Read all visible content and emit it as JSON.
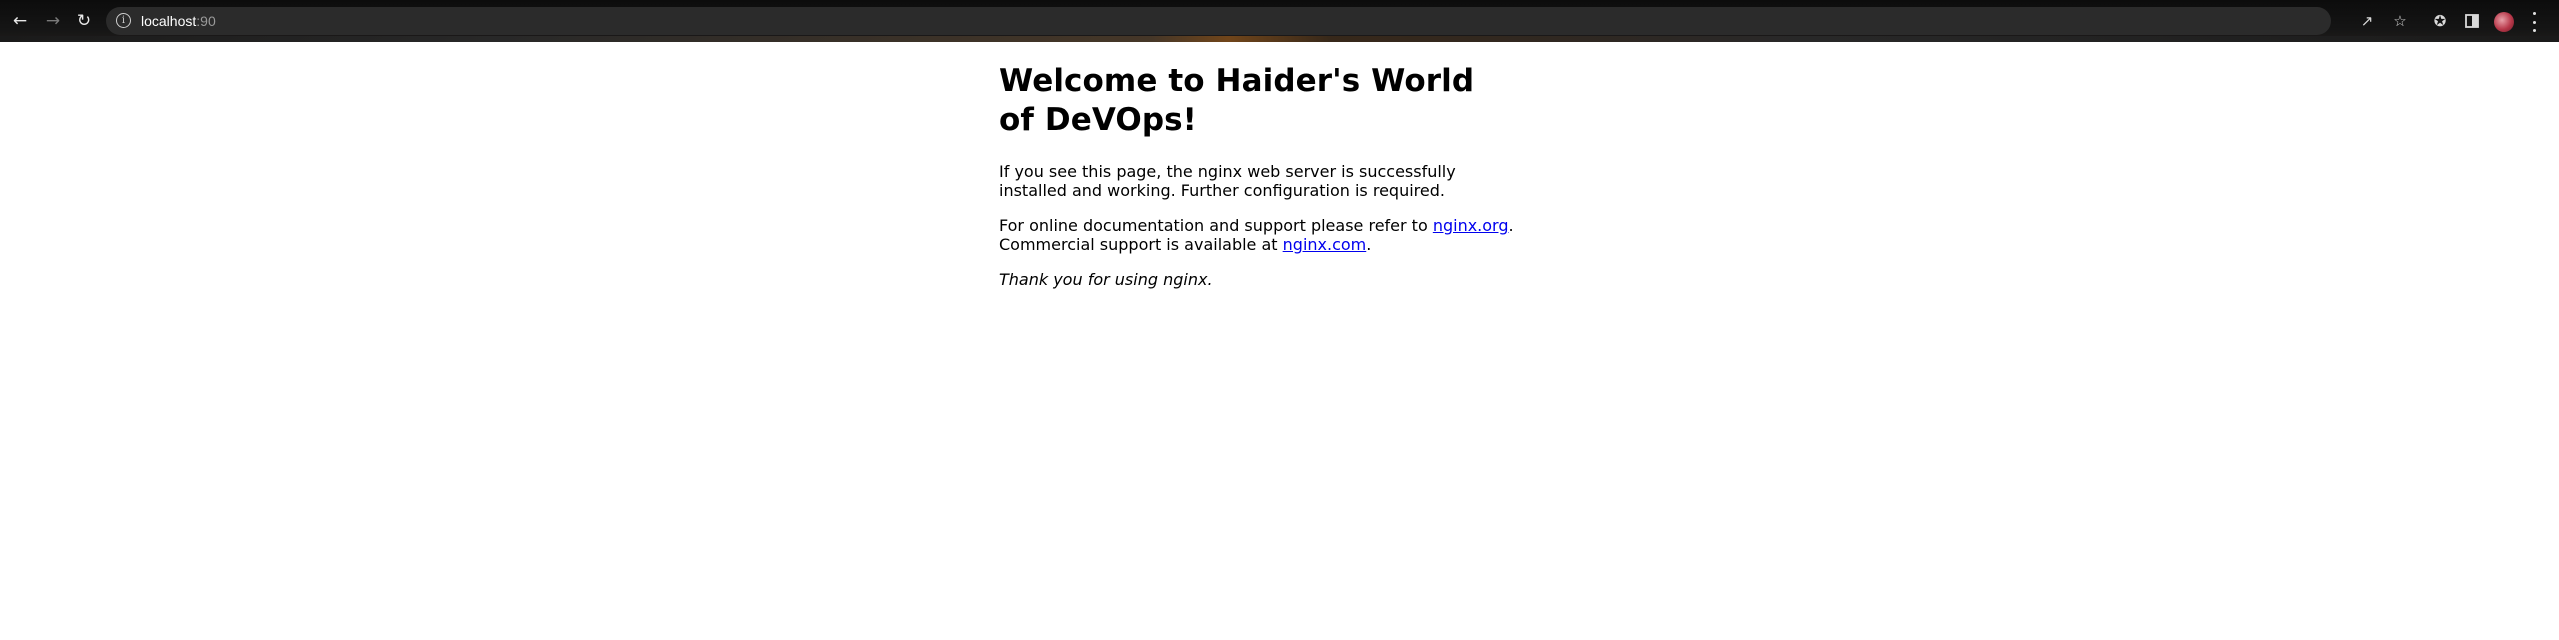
{
  "browser": {
    "url_host": "localhost",
    "url_port": ":90",
    "icons": {
      "back": "back-arrow-icon",
      "forward": "forward-arrow-icon",
      "reload": "reload-icon",
      "site_info": "info-icon",
      "share": "share-icon",
      "bookmark": "star-icon",
      "extensions": "puzzle-icon",
      "side_panel": "side-panel-icon",
      "profile": "avatar",
      "menu": "kebab-menu-icon"
    }
  },
  "page": {
    "heading": "Welcome to Haider's World of DeVOps!",
    "para1": "If you see this page, the nginx web server is successfully installed and working. Further configuration is required.",
    "para2_prefix": "For online documentation and support please refer to ",
    "link_org": "nginx.org",
    "para2_middle": ".",
    "para2_line2_prefix": "Commercial support is available at ",
    "link_com": "nginx.com",
    "para2_suffix": ".",
    "thanks": "Thank you for using nginx."
  },
  "colors": {
    "link": "#0000ee",
    "text": "#000000",
    "toolbar": "#151515",
    "omnibox": "#2b2b2b"
  }
}
